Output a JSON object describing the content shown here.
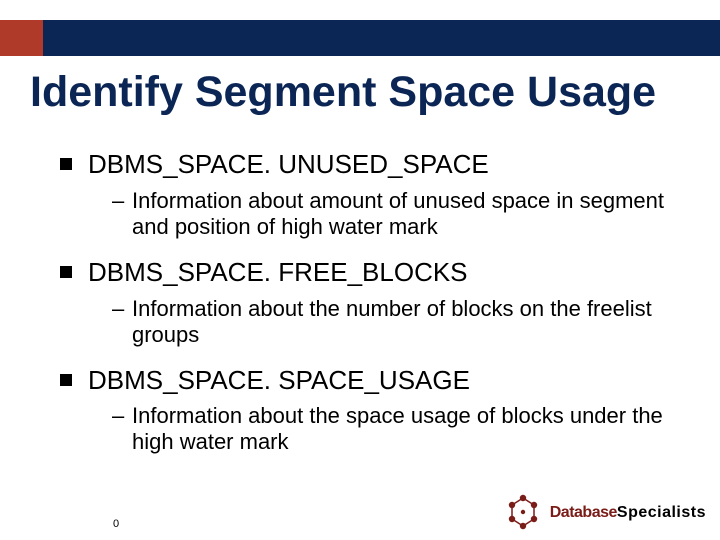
{
  "slide": {
    "title": "Identify Segment Space Usage",
    "items": [
      {
        "heading": "DBMS_SPACE. UNUSED_SPACE",
        "detail": "Information about amount of unused space in segment and position of high water mark"
      },
      {
        "heading": "DBMS_SPACE. FREE_BLOCKS",
        "detail": "Information about the number of blocks on the freelist groups"
      },
      {
        "heading": "DBMS_SPACE. SPACE_USAGE",
        "detail": "Information about the space usage of blocks under the high water mark"
      }
    ],
    "page_number": "0"
  },
  "logo": {
    "word1": "Database",
    "word2": "Specialists"
  }
}
